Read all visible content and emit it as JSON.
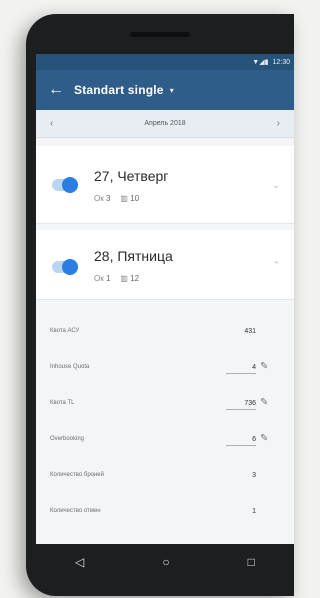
{
  "status": {
    "time": "12:30",
    "icons": "▼◢▮"
  },
  "appbar": {
    "title": "Standart single",
    "back_icon": "arrow-left-icon"
  },
  "month": {
    "label": "Апрель 2018"
  },
  "days": [
    {
      "title": "27, Четверг",
      "stat1_label": "Ок",
      "stat1_value": "3",
      "stat2_value": "10"
    },
    {
      "title": "28, Пятница",
      "stat1_label": "Ок",
      "stat2_value": "12",
      "stat1_value": "1"
    }
  ],
  "details": [
    {
      "label": "Квота АСУ",
      "value": "431"
    },
    {
      "label": "Inhouse Quota",
      "value": "4"
    },
    {
      "label": "Квота TL",
      "value": "736"
    },
    {
      "label": "Overbooking",
      "value": "6"
    },
    {
      "label": "Количество броней",
      "value": "3"
    },
    {
      "label": "Количество отмен",
      "value": "1"
    }
  ]
}
